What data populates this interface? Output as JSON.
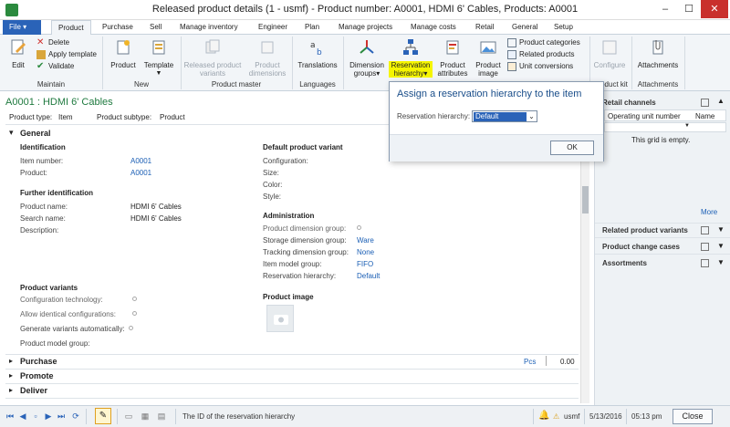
{
  "window": {
    "title": "Released product details (1 - usmf) - Product number: A0001, HDMI 6' Cables, Products: A0001",
    "min": "–",
    "max": "☐",
    "close": "✕"
  },
  "tabs": {
    "file": "File ▾",
    "items": [
      "Product",
      "Purchase",
      "Sell",
      "Manage inventory",
      "Engineer",
      "Plan",
      "Manage projects",
      "Manage costs",
      "Retail",
      "General",
      "Setup"
    ]
  },
  "ribbon": {
    "maintain": {
      "label": "Maintain",
      "edit": "Edit",
      "delete": "Delete",
      "apply_template": "Apply template",
      "validate": "Validate"
    },
    "new": {
      "label": "New",
      "product": "Product",
      "template": "Template"
    },
    "product_master": {
      "label": "Product master",
      "released_variants": "Released product variants",
      "product_dimensions": "Product dimensions"
    },
    "languages": {
      "label": "Languages",
      "translations": "Translations"
    },
    "set_up": {
      "dimension_groups": "Dimension groups▾",
      "reservation_hierarchy": "Reservation hierarchy▾",
      "product_attributes": "Product attributes",
      "product_image": "Product image",
      "product_categories": "Product categories",
      "related_products": "Related products",
      "unit_conversions": "Unit conversions"
    },
    "product_kit": {
      "label": "Product kit",
      "configure": "Configure"
    },
    "attachments": {
      "label": "Attachments",
      "attachments": "Attachments"
    }
  },
  "form": {
    "heading": "A0001 : HDMI 6' Cables",
    "product_type_label": "Product type:",
    "product_type": "Item",
    "product_subtype_label": "Product subtype:",
    "product_subtype": "Product",
    "general": "General",
    "identification": "Identification",
    "item_number_label": "Item number:",
    "item_number": "A0001",
    "product_label": "Product:",
    "product": "A0001",
    "further_identification": "Further identification",
    "product_name_label": "Product name:",
    "product_name": "HDMI 6' Cables",
    "search_name_label": "Search name:",
    "search_name": "HDMI 6' Cables",
    "description_label": "Description:",
    "product_variants": "Product variants",
    "config_tech_label": "Configuration technology:",
    "allow_identical_label": "Allow identical configurations:",
    "generate_variants_label": "Generate variants automatically:",
    "product_model_group_label": "Product model group:",
    "default_variant": "Default product variant",
    "configuration_label": "Configuration:",
    "size_label": "Size:",
    "color_label": "Color:",
    "style_label": "Style:",
    "administration": "Administration",
    "product_dim_group_label": "Product dimension group:",
    "storage_dim_group_label": "Storage dimension group:",
    "storage_dim_group": "Ware",
    "tracking_dim_group_label": "Tracking dimension group:",
    "tracking_dim_group": "None",
    "item_model_group_label": "Item model group:",
    "item_model_group": "FIFO",
    "reservation_hierarchy_label": "Reservation hierarchy:",
    "reservation_hierarchy": "Default",
    "product_image": "Product image",
    "purchase": "Purchase",
    "purchase_unit": "Pcs",
    "purchase_price": "0.00",
    "promote": "Promote",
    "deliver": "Deliver"
  },
  "dialog": {
    "title": "Assign a reservation hierarchy to the item",
    "field_label": "Reservation hierarchy:",
    "field_value": "Default",
    "ok": "OK"
  },
  "right_panel": {
    "retail_channels": "Retail channels",
    "col_operating_unit": "Operating unit number",
    "col_name": "Name",
    "empty": "This grid is empty.",
    "more": "More",
    "related_variants": "Related product variants",
    "change_cases": "Product change cases",
    "assortments": "Assortments"
  },
  "status": {
    "message": "The ID of the reservation hierarchy",
    "company": "usmf",
    "date": "5/13/2016",
    "time": "05:13 pm",
    "close": "Close"
  },
  "colors": {
    "accent": "#2a63b8",
    "heading": "#1f7a3f",
    "highlight": "#f5f500",
    "link": "#1b5fb5"
  }
}
